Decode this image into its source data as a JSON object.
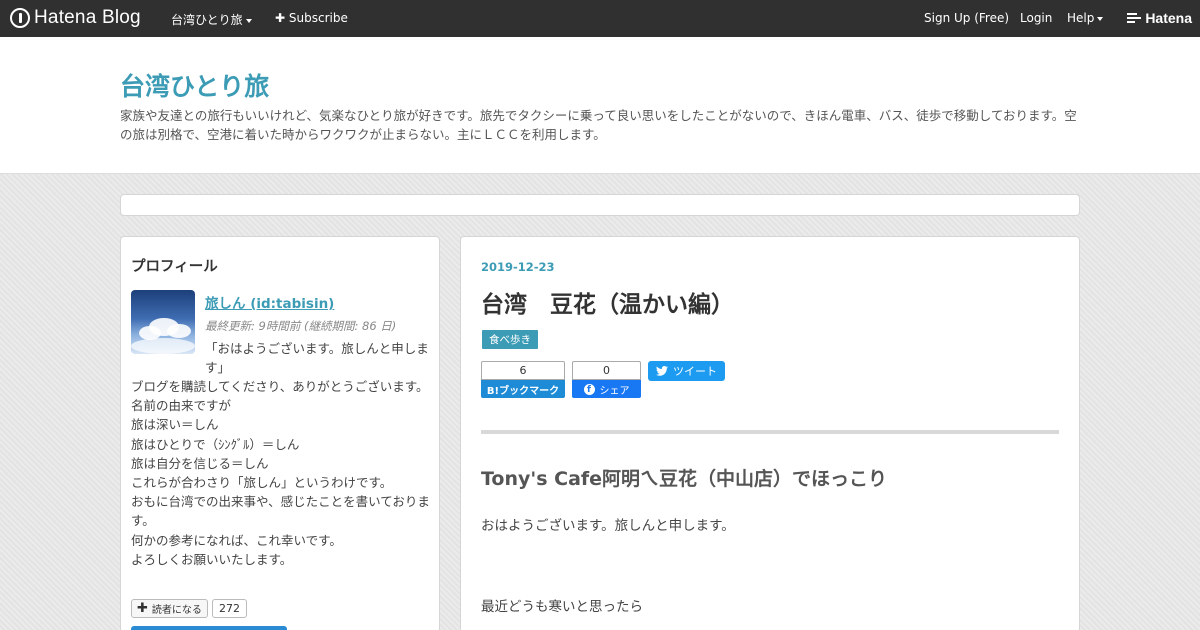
{
  "topbar": {
    "logo_text": "Hatena Blog",
    "blog_menu": "台湾ひとり旅",
    "subscribe": "Subscribe",
    "signup": "Sign Up (Free)",
    "login": "Login",
    "help": "Help",
    "brand": "Hatena"
  },
  "header": {
    "title": "台湾ひとり旅",
    "description": "家族や友達との旅行もいいけれど、気楽なひとり旅が好きです。旅先でタクシーに乗って良い思いをしたことがないので、きほん電車、バス、徒歩で移動しております。空の旅は別格で、空港に着いた時からワクワクが止まらない。主にＬＣＣを利用します。"
  },
  "sidebar": {
    "heading": "プロフィール",
    "name": "旅しん (id:tabisin)",
    "updated": "最終更新: 9時間前 (継続期間: 86 日)",
    "intro": "「おはようございます。旅しんと申します」",
    "lines": [
      "ブログを購読してくださり、ありがとうございます。",
      "名前の由来ですが",
      "旅は深い＝しん",
      "旅はひとりで（ｼﾝｸﾞﾙ）＝しん",
      "旅は自分を信じる＝しん",
      "これらが合わさり「旅しん」というわけです。",
      "おもに台湾での出来事や、感じたことを書いております。",
      "何かの参考になれば、これ幸いです。",
      "よろしくお願いいたします。"
    ],
    "reader_button": "読者になる",
    "reader_count": "272"
  },
  "article": {
    "date": "2019-12-23",
    "title": "台湾　豆花（温かい編）",
    "category": "食べ歩き",
    "bookmark_count": "6",
    "bookmark_label": "B!ブックマーク",
    "facebook_count": "0",
    "facebook_label": "シェア",
    "tweet_label": "ツイート",
    "heading": "Tony's Cafe阿明ㄟ豆花（中山店）でほっこり",
    "para1": "おはようございます。旅しんと申します。",
    "para2": "最近どうも寒いと思ったら"
  },
  "colors": {
    "accent": "#3c9bb5",
    "topbar_bg": "#303030",
    "hatena_bookmark": "#1d8bd6",
    "facebook": "#1877f2",
    "twitter": "#1d9bf0"
  }
}
